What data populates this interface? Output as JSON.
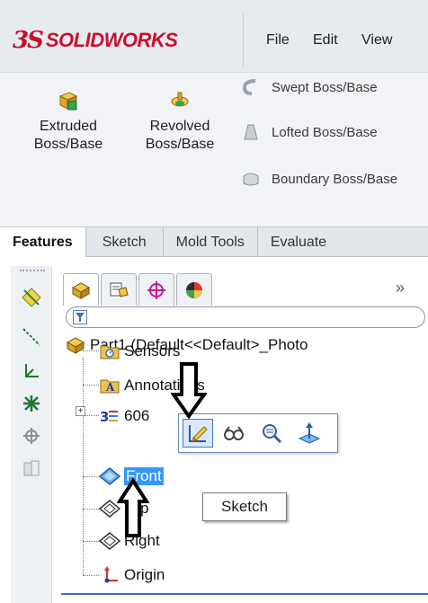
{
  "app": {
    "logo_prefix": "3S",
    "logo_text": "SOLIDWORKS",
    "brand_color": "#c8102e"
  },
  "menu": {
    "file": "File",
    "edit": "Edit",
    "view": "View"
  },
  "command_manager": {
    "extruded_line1": "Extruded",
    "extruded_line2": "Boss/Base",
    "revolved_line1": "Revolved",
    "revolved_line2": "Boss/Base",
    "swept": "Swept Boss/Base",
    "lofted": "Lofted Boss/Base",
    "boundary": "Boundary Boss/Base"
  },
  "tabs": {
    "features": "Features",
    "sketch": "Sketch",
    "mold_tools": "Mold Tools",
    "evaluate": "Evaluate"
  },
  "panel": {
    "chevron": "»",
    "tabs": [
      "feature-manager-icon",
      "property-manager-icon",
      "configuration-manager-icon",
      "display-manager-icon"
    ]
  },
  "tree": {
    "part": "Part1  (Default<<Default>_Photo",
    "sensors": "Sensors",
    "annotations": "Annotations",
    "material": "606",
    "front": "Front",
    "top": "Top",
    "right": "Right",
    "origin": "Origin"
  },
  "context_toolbar": {
    "items": [
      "edit-sketch-icon",
      "hide-show-icon",
      "zoom-to-selection-icon",
      "normal-to-icon"
    ]
  },
  "tooltip": {
    "text": "Sketch"
  },
  "selection_color": "#3399ff"
}
